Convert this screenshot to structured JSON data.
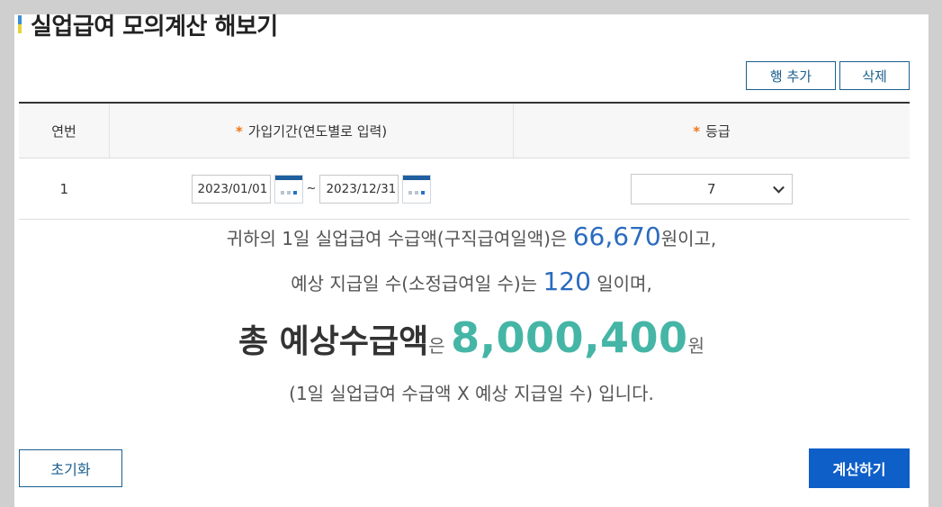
{
  "page_title": "실업급여 모의계산 해보기",
  "toolbar": {
    "add_row_label": "행 추가",
    "delete_label": "삭제"
  },
  "table": {
    "headers": [
      "연번",
      "가입기간(연도별로 입력)",
      "등급"
    ],
    "required_marker": "*",
    "rows": [
      {
        "no": "1",
        "start_date": "2023/01/01",
        "end_date": "2023/12/31",
        "separator": "~",
        "grade": "7"
      }
    ]
  },
  "result": {
    "line1_prefix": "귀하의 1일 실업급여 수급액(구직급여일액)은 ",
    "daily_amount": "66,670",
    "line1_suffix": "원이고,",
    "line2_prefix": "예상 지급일 수(소정급여일 수)는 ",
    "days": "120",
    "line2_suffix": " 일이며,",
    "total_label": "총 예상수급액",
    "total_particle": "은 ",
    "total_amount": "8,000,400",
    "total_unit": "원",
    "formula_note": "(1일 실업급여 수급액 X 예상 지급일 수) 입니다."
  },
  "actions": {
    "reset_label": "초기화",
    "calculate_label": "계산하기"
  },
  "colors": {
    "accent": "#0e5fc8",
    "total": "#45b5a6",
    "highlight": "#2a6bbf",
    "required": "#ee7a1f"
  }
}
